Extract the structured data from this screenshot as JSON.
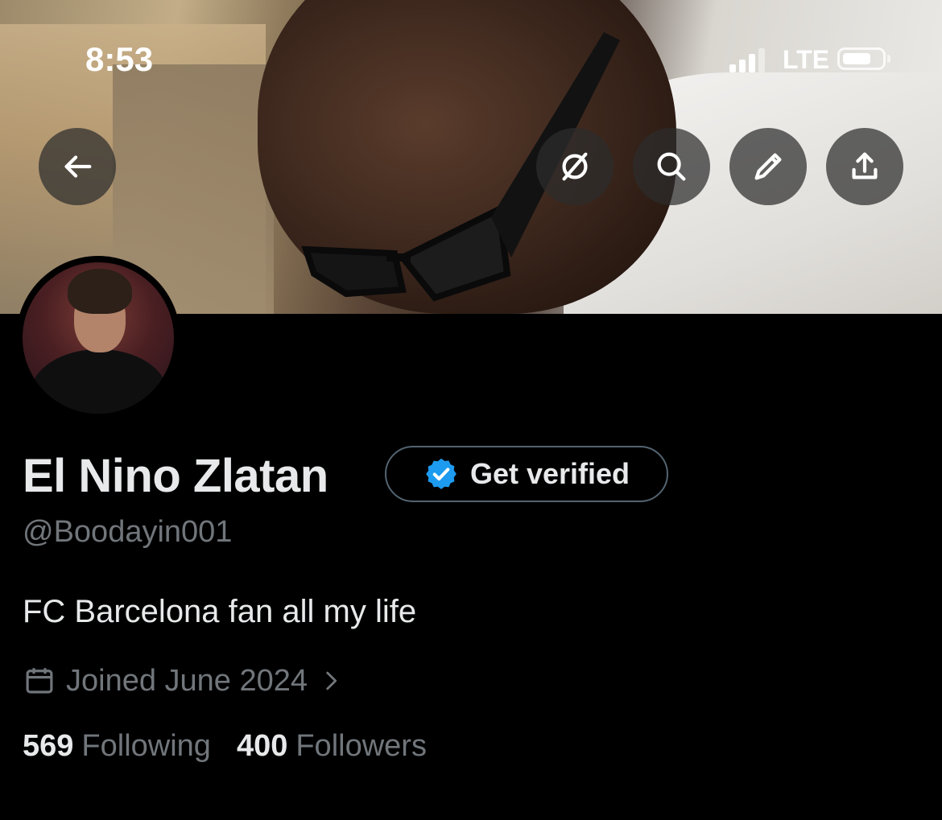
{
  "status_bar": {
    "time": "8:53",
    "network": "LTE"
  },
  "header_actions": {
    "back_icon": "arrow-left-icon",
    "grok_icon": "grok-icon",
    "search_icon": "search-icon",
    "edit_icon": "pencil-icon",
    "share_icon": "share-icon"
  },
  "profile": {
    "display_name": "El Nino Zlatan",
    "get_verified_label": "Get verified",
    "handle": "@Boodayin001",
    "bio": "FC Barcelona fan all my life",
    "joined": "Joined June 2024",
    "following_count": "569",
    "following_label": "Following",
    "followers_count": "400",
    "followers_label": "Followers"
  },
  "colors": {
    "background": "#000000",
    "primary_text": "#e7e9ea",
    "secondary_text": "#71767b",
    "verified_blue": "#1d9bf0",
    "button_border": "#536471"
  }
}
